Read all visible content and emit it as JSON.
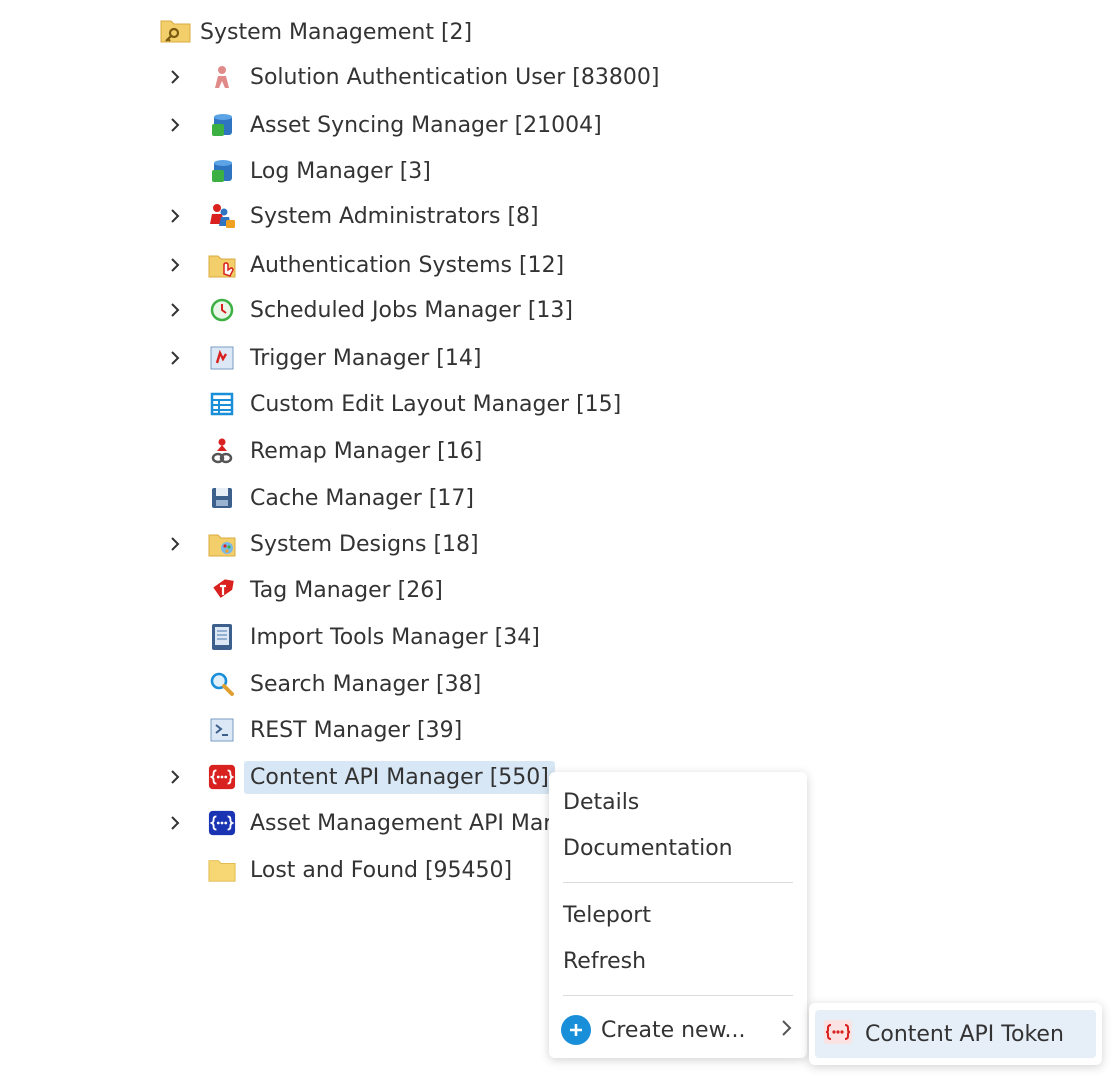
{
  "root": {
    "label": "System Management [2]",
    "icon": "folder-key-icon"
  },
  "tree": {
    "items": [
      {
        "label": "Solution Authentication User [83800]",
        "icon": "user-icon",
        "expandable": true
      },
      {
        "label": "Asset Syncing Manager [21004]",
        "icon": "database-icon",
        "expandable": true
      },
      {
        "label": "Log Manager [3]",
        "icon": "database-icon",
        "expandable": false
      },
      {
        "label": "System Administrators [8]",
        "icon": "user-group-lock-icon",
        "expandable": true
      },
      {
        "label": "Authentication Systems [12]",
        "icon": "folder-hand-icon",
        "expandable": true
      },
      {
        "label": "Scheduled Jobs Manager [13]",
        "icon": "clock-icon",
        "expandable": true
      },
      {
        "label": "Trigger Manager [14]",
        "icon": "trigger-icon",
        "expandable": true
      },
      {
        "label": "Custom Edit Layout Manager [15]",
        "icon": "layout-grid-icon",
        "expandable": false
      },
      {
        "label": "Remap Manager [16]",
        "icon": "remap-chain-icon",
        "expandable": false
      },
      {
        "label": "Cache Manager [17]",
        "icon": "floppy-disk-icon",
        "expandable": false
      },
      {
        "label": "System Designs [18]",
        "icon": "folder-palette-icon",
        "expandable": true
      },
      {
        "label": "Tag Manager [26]",
        "icon": "tag-icon",
        "expandable": false
      },
      {
        "label": "Import Tools Manager [34]",
        "icon": "import-tools-icon",
        "expandable": false
      },
      {
        "label": "Search Manager [38]",
        "icon": "magnifier-icon",
        "expandable": false
      },
      {
        "label": "REST Manager [39]",
        "icon": "terminal-icon",
        "expandable": false
      },
      {
        "label": "Content API Manager [550]",
        "icon": "content-api-icon",
        "expandable": true,
        "selected": true
      },
      {
        "label": "Asset Management API Mar",
        "icon": "asset-api-icon",
        "expandable": true
      },
      {
        "label": "Lost and Found [95450]",
        "icon": "folder-icon",
        "expandable": false
      }
    ]
  },
  "context_menu": {
    "details": "Details",
    "documentation": "Documentation",
    "teleport": "Teleport",
    "refresh": "Refresh",
    "create_new": "Create new..."
  },
  "submenu": {
    "content_api_token": "Content API Token",
    "icon": "content-api-token-icon"
  },
  "colors": {
    "selection": "#d8e7f5",
    "accent": "#1a8fd9",
    "api_red": "#d9211f",
    "api_blue": "#1a33b3"
  }
}
